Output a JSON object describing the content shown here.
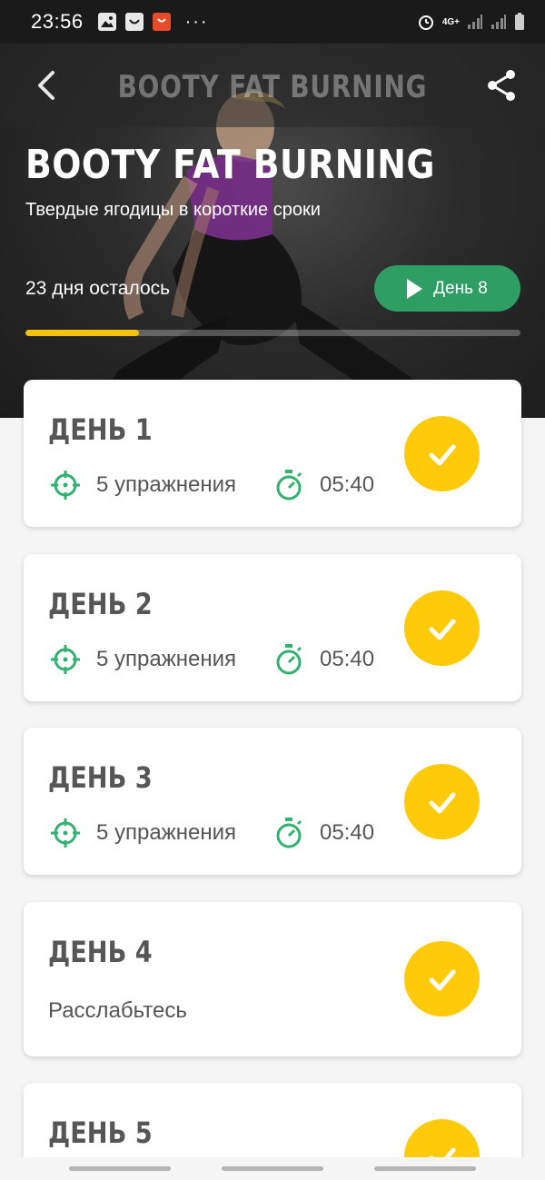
{
  "status_bar": {
    "time": "23:56",
    "icons_left": [
      "gallery-icon",
      "smile-app-icon",
      "aliexpress-icon",
      "more-dots-icon"
    ],
    "more": "···",
    "network": "4G+",
    "icons_right": [
      "alarm-icon",
      "network-icon",
      "signal-icon",
      "signal-icon",
      "battery-icon"
    ]
  },
  "header": {
    "title": "BOOTY FAT BURNING",
    "back_icon": "chevron-left-icon",
    "share_icon": "share-icon"
  },
  "hero": {
    "title": "BOOTY FAT BURNING",
    "subtitle": "Твердые ягодицы в короткие сроки",
    "days_left": "23 дня осталось",
    "start_button": "День 8",
    "progress": 0.23
  },
  "days": [
    {
      "title": "ДЕНЬ 1",
      "exercises": "5 упражнения",
      "duration": "05:40",
      "completed": true
    },
    {
      "title": "ДЕНЬ 2",
      "exercises": "5 упражнения",
      "duration": "05:40",
      "completed": true
    },
    {
      "title": "ДЕНЬ 3",
      "exercises": "5 упражнения",
      "duration": "05:40",
      "completed": true
    },
    {
      "title": "ДЕНЬ 4",
      "rest": "Расслабьтесь",
      "completed": true
    },
    {
      "title": "ДЕНЬ 5",
      "completed": true
    }
  ],
  "colors": {
    "accent_green": "#2e9e62",
    "check_yellow": "#ffca0a",
    "progress_yellow": "#f5c211",
    "icon_green": "#33b173"
  }
}
